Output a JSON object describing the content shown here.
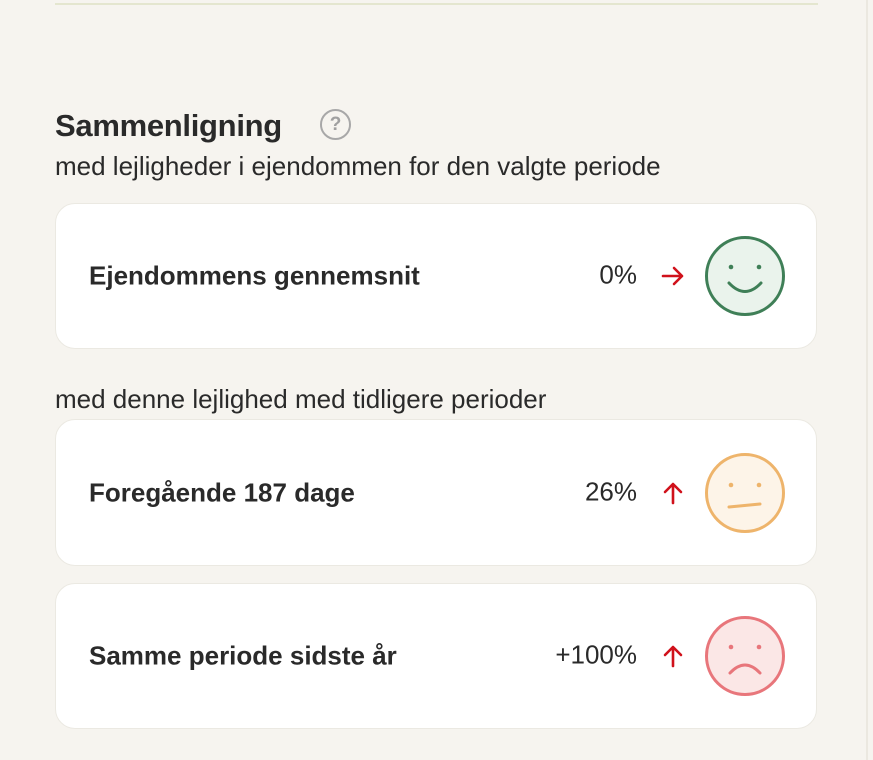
{
  "comparison": {
    "title": "Sammenligning",
    "help_icon_glyph": "?",
    "subtitle_property": "med lejligheder i ejendommen for den valgte periode",
    "subtitle_history": "med denne lejlighed med tidligere perioder"
  },
  "cards": [
    {
      "label": "Ejendommens gennemsnit",
      "value": "0%",
      "arrow": "arrow-right-icon",
      "face": "happy-face-icon",
      "face_color": "#3f7f57",
      "face_bg": "#eaf3ec",
      "arrow_color": "#d0111b"
    },
    {
      "label": "Foregående 187 dage",
      "value": "26%",
      "arrow": "arrow-up-icon",
      "face": "neutral-face-icon",
      "face_color": "#eeb46b",
      "face_bg": "#fdf4e8",
      "arrow_color": "#d0111b"
    },
    {
      "label": "Samme periode sidste år",
      "value": "+100%",
      "arrow": "arrow-up-icon",
      "face": "sad-face-icon",
      "face_color": "#e8767b",
      "face_bg": "#fbe7e6",
      "arrow_color": "#d0111b"
    }
  ]
}
